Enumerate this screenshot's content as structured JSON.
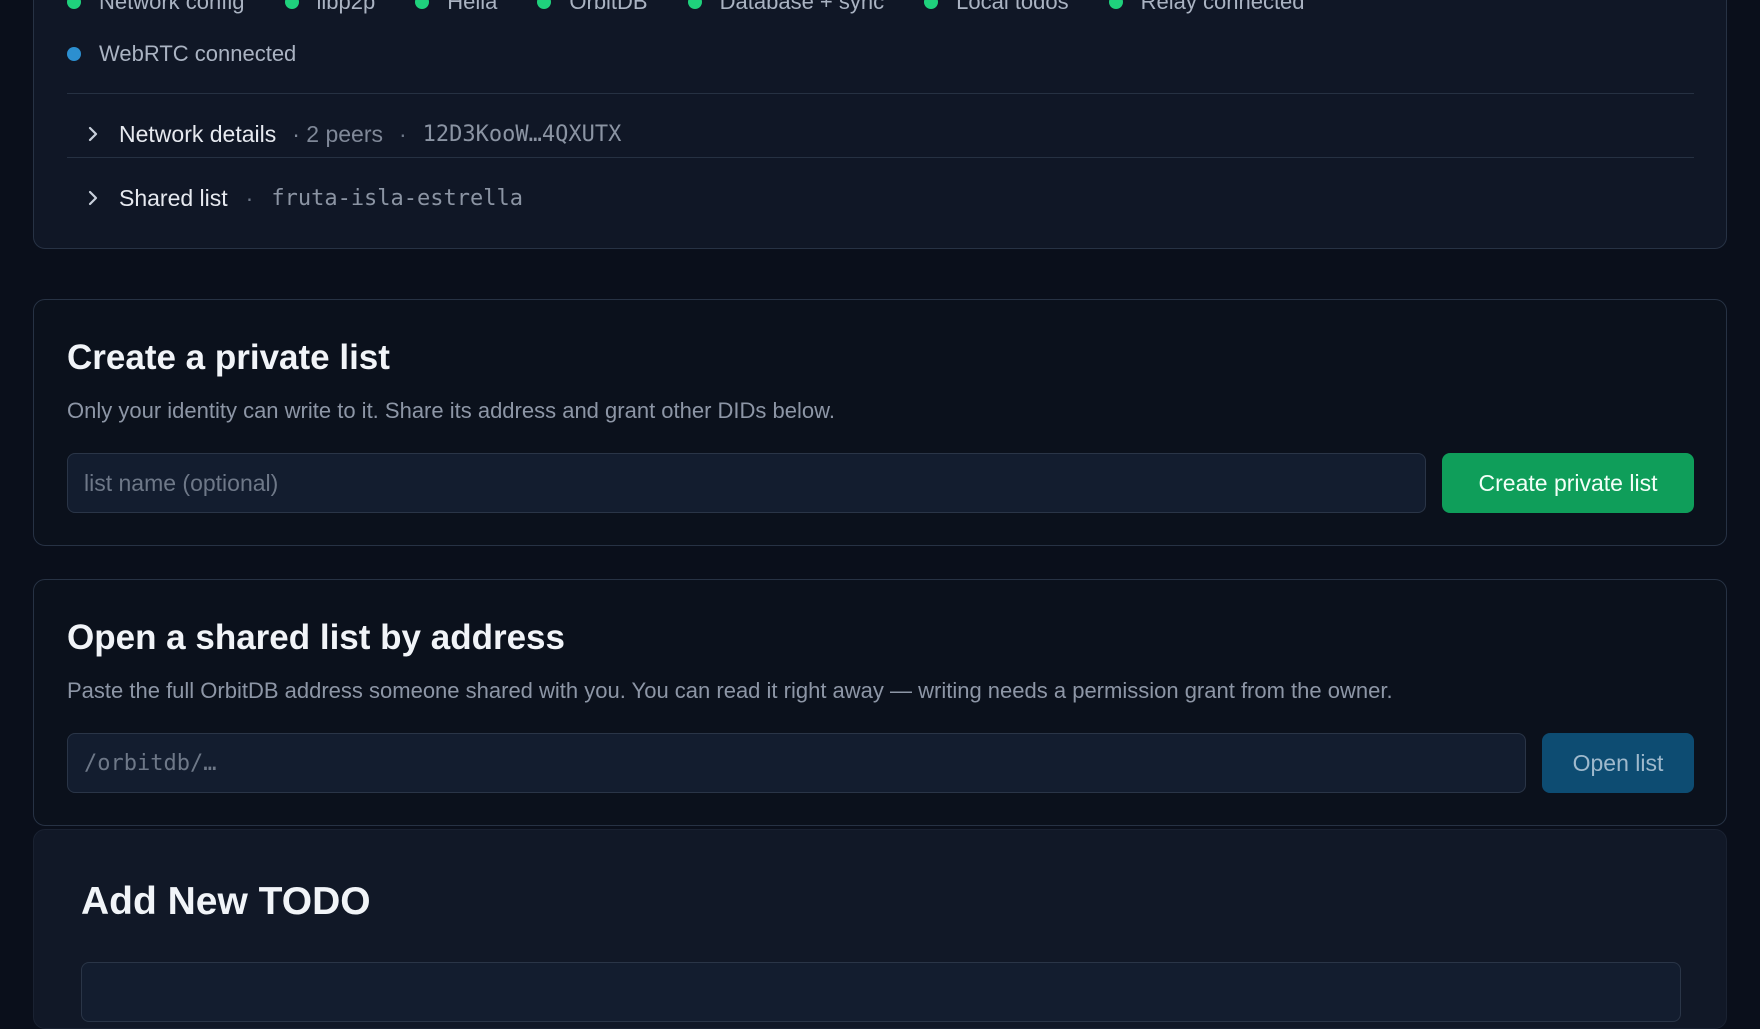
{
  "status": {
    "items": [
      {
        "label": "Network config",
        "color": "#1fd17c"
      },
      {
        "label": "libp2p",
        "color": "#1fd17c"
      },
      {
        "label": "Helia",
        "color": "#1fd17c"
      },
      {
        "label": "OrbitDB",
        "color": "#1fd17c"
      },
      {
        "label": "Database + sync",
        "color": "#1fd17c"
      },
      {
        "label": "Local todos",
        "color": "#1fd17c"
      },
      {
        "label": "Relay connected",
        "color": "#1fd17c"
      }
    ],
    "webrtc": {
      "label": "WebRTC connected",
      "color": "#2c8fd0"
    }
  },
  "network_details": {
    "title": "Network details",
    "peers": "· 2 peers",
    "peer_id": "12D3KooW…4QXUTX"
  },
  "shared_list": {
    "title": "Shared list",
    "name": "fruta-isla-estrella"
  },
  "create_private": {
    "title": "Create a private list",
    "description": "Only your identity can write to it. Share its address and grant other DIDs below.",
    "input_placeholder": "list name (optional)",
    "button_label": "Create private list"
  },
  "open_shared": {
    "title": "Open a shared list by address",
    "description": "Paste the full OrbitDB address someone shared with you. You can read it right away — writing needs a permission grant from the owner.",
    "input_placeholder": "/orbitdb/…",
    "button_label": "Open list"
  },
  "add_todo": {
    "title": "Add New TODO"
  }
}
